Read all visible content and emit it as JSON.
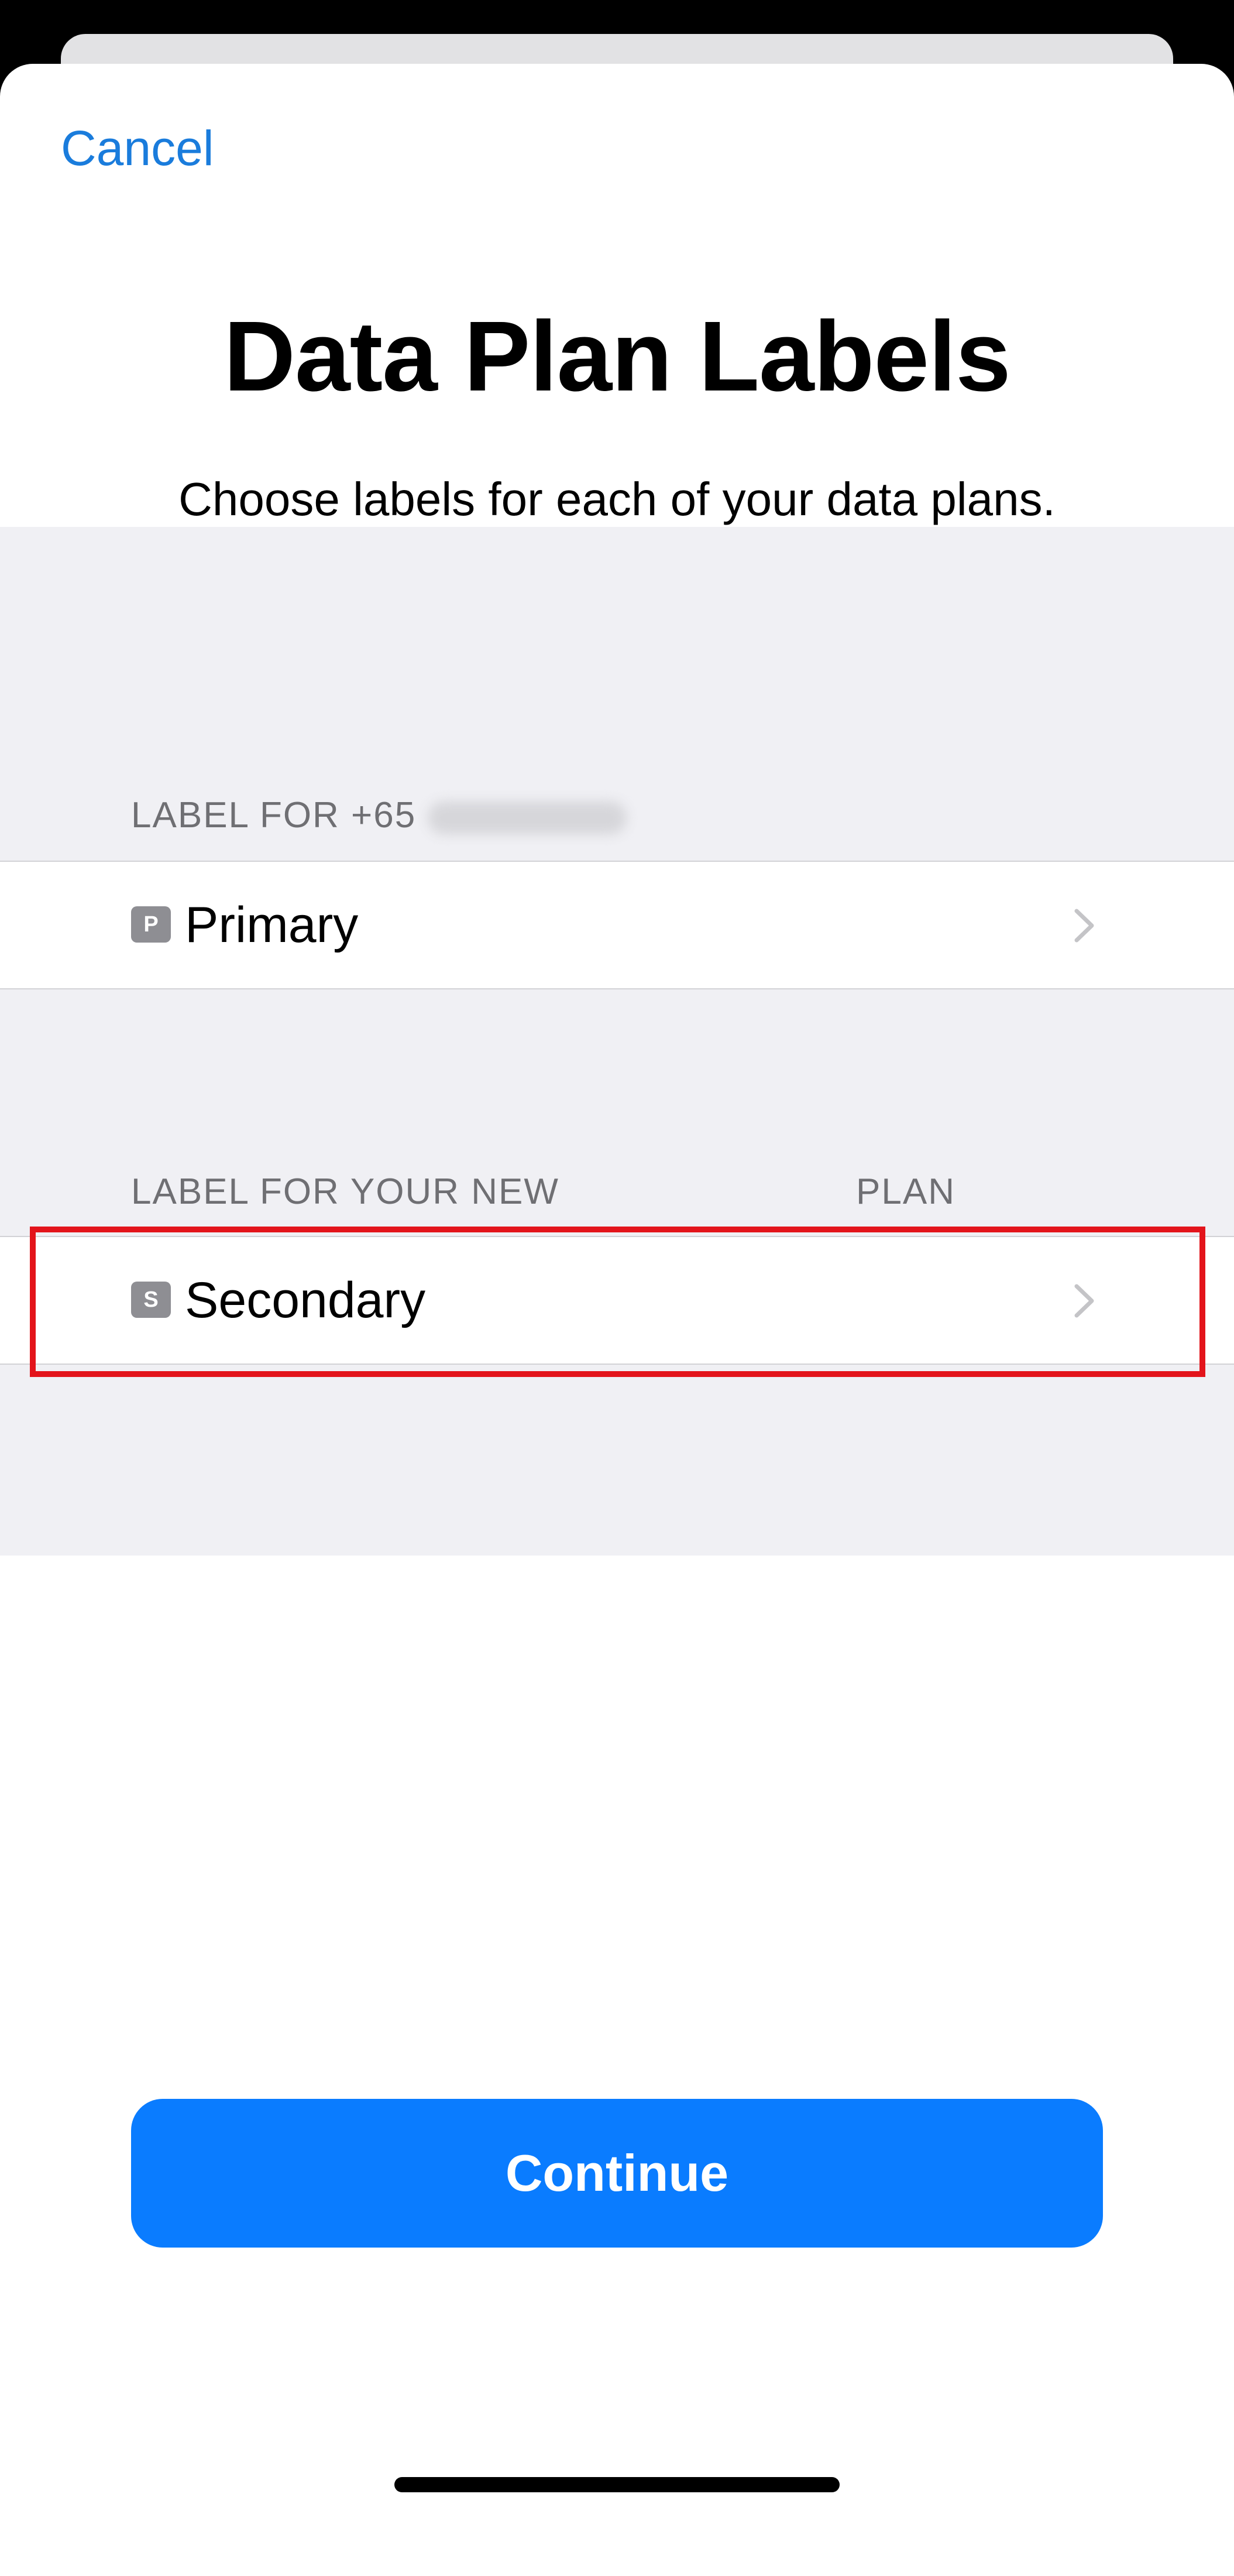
{
  "sheet": {
    "cancel_label": "Cancel",
    "title": "Data Plan Labels",
    "subtitle": "Choose labels for each of your data plans."
  },
  "sections": [
    {
      "header": "LABEL FOR +65",
      "header_value_redacted": true,
      "row": {
        "badge": "P",
        "label": "Primary",
        "icon": "chevron-right-icon"
      }
    },
    {
      "header": "LABEL FOR YOUR NEW",
      "header_suffix": "PLAN",
      "row": {
        "badge": "S",
        "label": "Secondary",
        "icon": "chevron-right-icon",
        "highlighted": true
      }
    }
  ],
  "continue_button": {
    "label": "Continue"
  },
  "colors": {
    "accent_link": "#1a7cdc",
    "button_fill": "#0a7cff",
    "highlight_outline": "#e3141b",
    "grouped_background": "#f0f0f4",
    "badge_fill": "#8e8e93"
  }
}
